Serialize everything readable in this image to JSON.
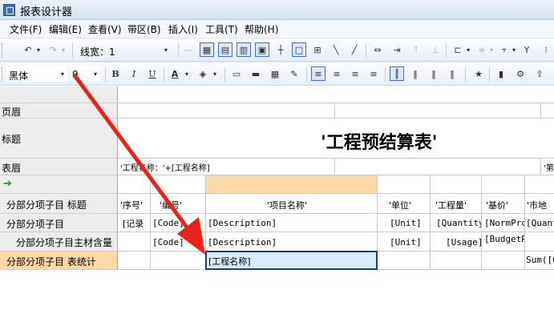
{
  "window": {
    "title": "报表设计器"
  },
  "menu": [
    "文件(F)",
    "编辑(E)",
    "查看(V)",
    "带区(B)",
    "插入(I)",
    "工具(T)",
    "帮助(H)"
  ],
  "toolbar1": {
    "line_width_label": "线宽：1"
  },
  "toolbar2": {
    "font_name": "黑体",
    "font_size": "9",
    "bold_label": "B",
    "italic_label": "I",
    "underline_label": "U",
    "font_color_label": "A"
  },
  "bands": {
    "page_header": "页眉",
    "title": "标题",
    "table_header": "表眉",
    "detail_title": "分部分项子目 标题",
    "detail": "分部分项子目",
    "detail_material": "分部分项子目主材含量",
    "detail_total": "分部分项子目 表统计"
  },
  "report": {
    "title_cell": "'工程预结算表'",
    "header_cell": "'工程名称：'+[工程名称]",
    "header_cell_right": "'第"
  },
  "columns": [
    "'序号'",
    "'编号'",
    "'项目名称'",
    "'单位'",
    "'工程量'",
    "'基价'",
    "'市地"
  ],
  "detail_row": [
    "[记录",
    "[Code]",
    "[Description]",
    "[Unit]",
    "[Quantity",
    "[NormPro",
    "[Quant"
  ],
  "material_row": [
    "",
    "[Code]",
    "[Description]",
    "[Unit]",
    "[Usage]",
    "[BudgetR",
    ""
  ],
  "total_row": {
    "selected_cell": "[工程名称]",
    "sum_cell": "Sum([Q"
  },
  "colors": {
    "accent_selected_band": "#fdd9a6",
    "arrow": "#e8231c",
    "selection_border": "#233f72"
  }
}
